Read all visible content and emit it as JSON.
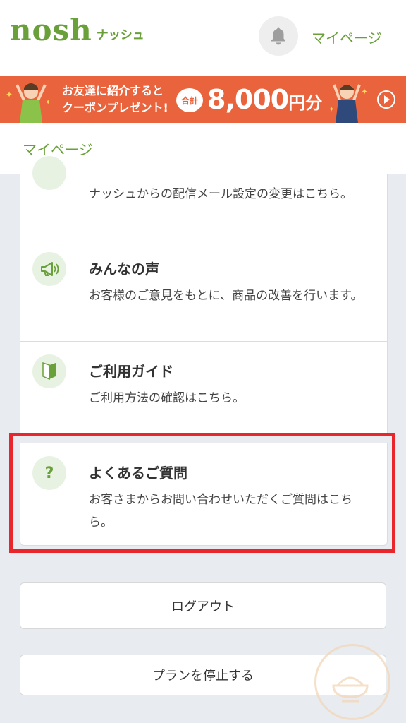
{
  "header": {
    "logo_main": "nosh",
    "logo_sub": "ナッシュ",
    "mypage_label": "マイページ",
    "icon": "bell-icon"
  },
  "banner": {
    "line1": "お友達に紹介すると",
    "line2": "クーポンプレゼント!",
    "total_badge": "合計",
    "amount": "8,000",
    "amount_unit": "円分",
    "play_icon": "play-icon"
  },
  "breadcrumb": {
    "label": "マイページ"
  },
  "menu": {
    "items": [
      {
        "desc": "ナッシュからの配信メール設定の変更はこちら。"
      },
      {
        "title": "みんなの声",
        "desc": "お客様のご意見をもとに、商品の改善を行います。",
        "icon": "megaphone-icon"
      },
      {
        "title": "ご利用ガイド",
        "desc": "ご利用方法の確認はこちら。",
        "icon": "beginner-mark-icon"
      },
      {
        "title": "よくあるご質問",
        "desc": "お客さまからお問い合わせいただくご質問はこちら。",
        "icon": "question-icon"
      }
    ]
  },
  "buttons": {
    "logout": "ログアウト",
    "stop_plan": "プランを停止する"
  },
  "colors": {
    "brand_green": "#6aa03a",
    "banner_orange": "#e9633c",
    "highlight_red": "#e8262b"
  }
}
